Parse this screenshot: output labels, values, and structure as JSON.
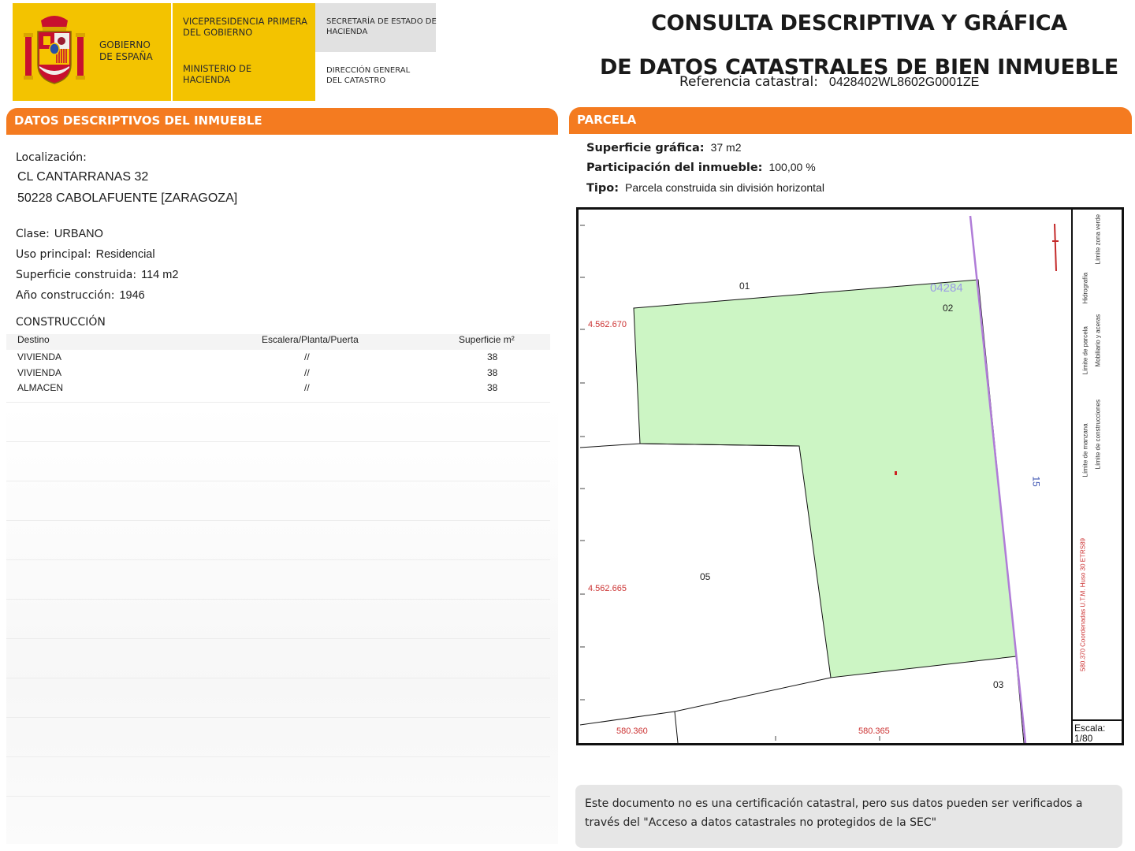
{
  "header": {
    "gobierno": "GOBIERNO DE ESPAÑA",
    "vicepresidencia": "VICEPRESIDENCIA PRIMERA DEL GOBIERNO",
    "ministerio": "MINISTERIO DE HACIENDA",
    "secretaria": "SECRETARÍA DE ESTADO DE HACIENDA",
    "direccion": "DIRECCIÓN GENERAL DEL CATASTRO",
    "title_line1": "CONSULTA DESCRIPTIVA Y GRÁFICA",
    "title_line2": "DE DATOS CATASTRALES DE BIEN INMUEBLE",
    "ref_label": "Referencia catastral:",
    "ref_value": "0428402WL8602G0001ZE",
    "brand_yellow": "#f3c300",
    "brand_orange": "#f47b20"
  },
  "left": {
    "section_title": "DATOS DESCRIPTIVOS DEL INMUEBLE",
    "localizacion_label": "Localización:",
    "address_line1": "CL CANTARRANAS 32",
    "address_line2": "50228 CABOLAFUENTE [ZARAGOZA]",
    "clase_label": "Clase:",
    "clase_value": "URBANO",
    "uso_label": "Uso principal:",
    "uso_value": "Residencial",
    "superficie_label": "Superficie construida:",
    "superficie_value": "114 m2",
    "anio_label": "Año construcción:",
    "anio_value": "1946",
    "construccion_title": "CONSTRUCCIÓN",
    "table_headers": [
      "Destino",
      "Escalera/Planta/Puerta",
      "Superficie m²"
    ],
    "table_rows": [
      [
        "VIVIENDA",
        "//",
        "38"
      ],
      [
        "VIVIENDA",
        "//",
        "38"
      ],
      [
        "ALMACEN",
        "//",
        "38"
      ]
    ]
  },
  "right": {
    "section_title": "PARCELA",
    "superficie_label": "Superficie gráfica:",
    "superficie_value": "37 m2",
    "participacion_label": "Participación del inmueble:",
    "participacion_value": "100,00 %",
    "tipo_label": "Tipo:",
    "tipo_value": "Parcela construida sin división horizontal",
    "map": {
      "parcel_labels": [
        "01",
        "02",
        "03",
        "05"
      ],
      "block_label": "04284",
      "y_coord_top": "4.562.670",
      "y_coord_bottom": "4.562.665",
      "x_coord_left": "580.360",
      "x_coord_right": "580.365",
      "street_number": "15",
      "legend_items": [
        "Hidrografía",
        "Límite zona verde",
        "Límite de parcela",
        "Mobiliario y aceras",
        "Límite de manzana",
        "Límite de construcciones"
      ],
      "coord_note": "580.370 Coordenadas U.T.M. Huso 30 ETRS89",
      "scale_label": "Escala:",
      "scale_value": "1/80",
      "parcel_fill": "#ccf5c4"
    },
    "note": "Este documento no es una certificación catastral, pero sus datos pueden ser verificados a través del \"Acceso a datos catastrales no protegidos de la SEC\""
  }
}
